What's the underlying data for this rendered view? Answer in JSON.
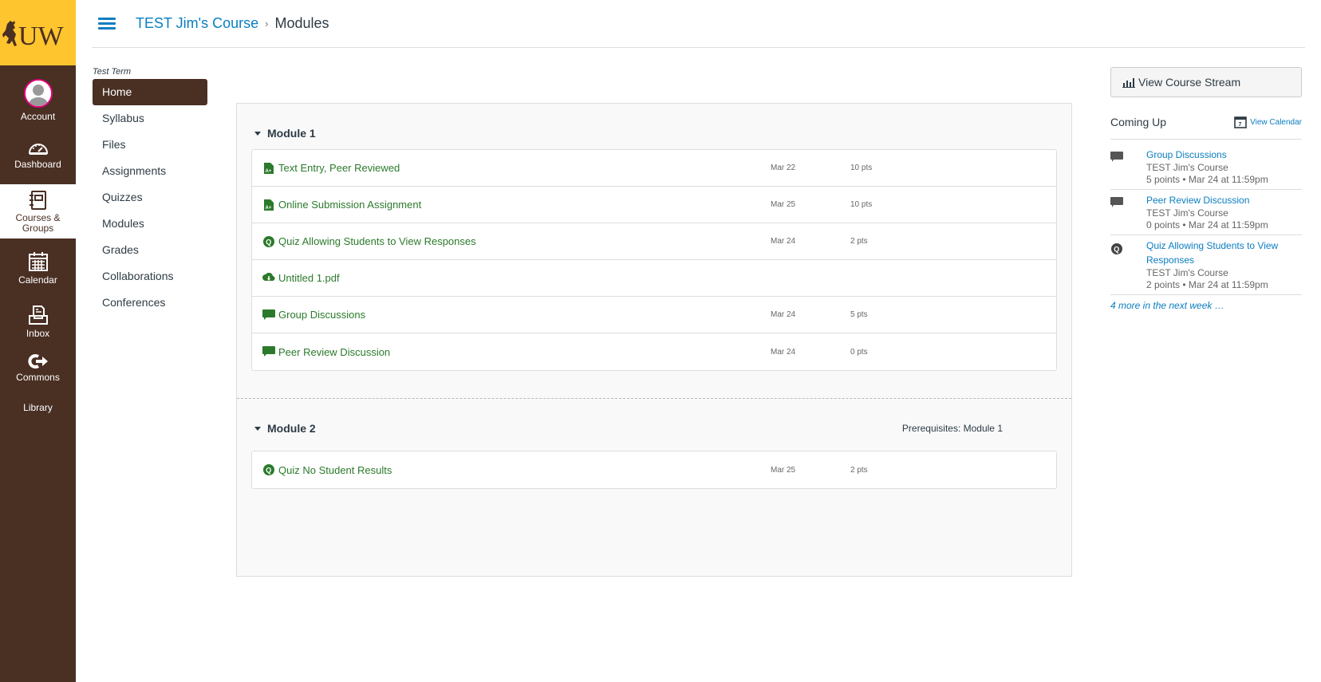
{
  "global_nav": {
    "logo_text": "UW",
    "items": [
      {
        "label": "Account",
        "icon": "avatar-icon",
        "active": false
      },
      {
        "label": "Dashboard",
        "icon": "dashboard-icon",
        "active": false
      },
      {
        "label": "Courses & Groups",
        "icon": "courses-icon",
        "active": true
      },
      {
        "label": "Calendar",
        "icon": "calendar-icon",
        "active": false
      },
      {
        "label": "Inbox",
        "icon": "inbox-icon",
        "active": false
      },
      {
        "label": "Commons",
        "icon": "commons-icon",
        "active": false
      },
      {
        "label": "Library",
        "icon": "",
        "active": false
      }
    ]
  },
  "breadcrumb": {
    "course": "TEST Jim's Course",
    "separator": "›",
    "current": "Modules"
  },
  "course_nav": {
    "term": "Test Term",
    "items": [
      "Home",
      "Syllabus",
      "Files",
      "Assignments",
      "Quizzes",
      "Modules",
      "Grades",
      "Collaborations",
      "Conferences"
    ],
    "active": "Home"
  },
  "modules": [
    {
      "name": "Module 1",
      "prerequisites": "",
      "items": [
        {
          "type": "assignment",
          "title": "Text Entry, Peer Reviewed",
          "date": "Mar 22",
          "points": "10 pts"
        },
        {
          "type": "assignment",
          "title": "Online Submission Assignment",
          "date": "Mar 25",
          "points": "10 pts"
        },
        {
          "type": "quiz",
          "title": "Quiz Allowing Students to View Responses",
          "date": "Mar 24",
          "points": "2 pts"
        },
        {
          "type": "file",
          "title": "Untitled 1.pdf",
          "date": "",
          "points": ""
        },
        {
          "type": "discussion",
          "title": "Group Discussions",
          "date": "Mar 24",
          "points": "5 pts"
        },
        {
          "type": "discussion",
          "title": "Peer Review Discussion",
          "date": "Mar 24",
          "points": "0 pts"
        }
      ]
    },
    {
      "name": "Module 2",
      "prerequisites": "Prerequisites: Module 1",
      "items": [
        {
          "type": "quiz",
          "title": "Quiz No Student Results",
          "date": "Mar 25",
          "points": "2 pts"
        }
      ]
    }
  ],
  "sidebar": {
    "stream_button": "View Course Stream",
    "coming_up_title": "Coming Up",
    "view_calendar": "View Calendar",
    "calendar_day": "7",
    "coming_up": [
      {
        "type": "discussion",
        "title": "Group Discussions",
        "course": "TEST Jim's Course",
        "details": "5 points • Mar 24 at 11:59pm"
      },
      {
        "type": "discussion",
        "title": "Peer Review Discussion",
        "course": "TEST Jim's Course",
        "details": "0 points • Mar 24 at 11:59pm"
      },
      {
        "type": "quiz",
        "title": "Quiz Allowing Students to View Responses",
        "course": "TEST Jim's Course",
        "details": "2 points • Mar 24 at 11:59pm"
      }
    ],
    "more_link": "4 more in the next week …"
  },
  "colors": {
    "brand_brown": "#4a2f23",
    "brand_gold": "#fec52e",
    "link_blue": "#0a7ec0",
    "item_green": "#2b7a2b"
  }
}
